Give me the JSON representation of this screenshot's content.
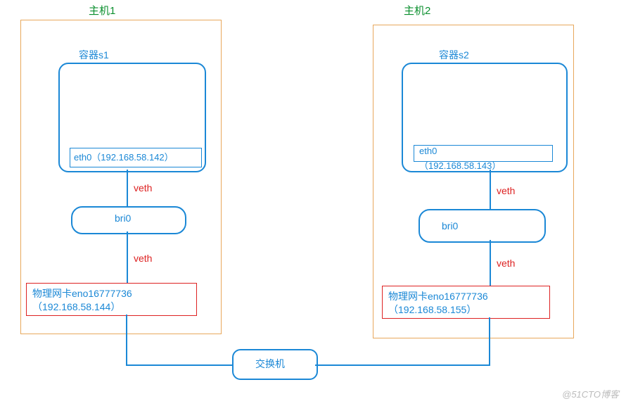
{
  "host1": {
    "title": "主机1",
    "container_label": "容器s1",
    "eth_label": "eth0（192.168.58.142）",
    "veth_upper": "veth",
    "bridge_label": "bri0",
    "veth_lower": "veth",
    "nic_label": "物理网卡eno16777736",
    "nic_ip": "（192.168.58.144）"
  },
  "host2": {
    "title": "主机2",
    "container_label": "容器s2",
    "eth_label_line1": "eth0",
    "eth_label_line2": "（192.168.58.143）",
    "veth_upper": "veth",
    "bridge_label": "bri0",
    "veth_lower": "veth",
    "nic_label": "物理网卡eno16777736",
    "nic_ip": "（192.168.58.155）"
  },
  "switch": {
    "label": "交换机"
  },
  "watermark": "@51CTO博客"
}
